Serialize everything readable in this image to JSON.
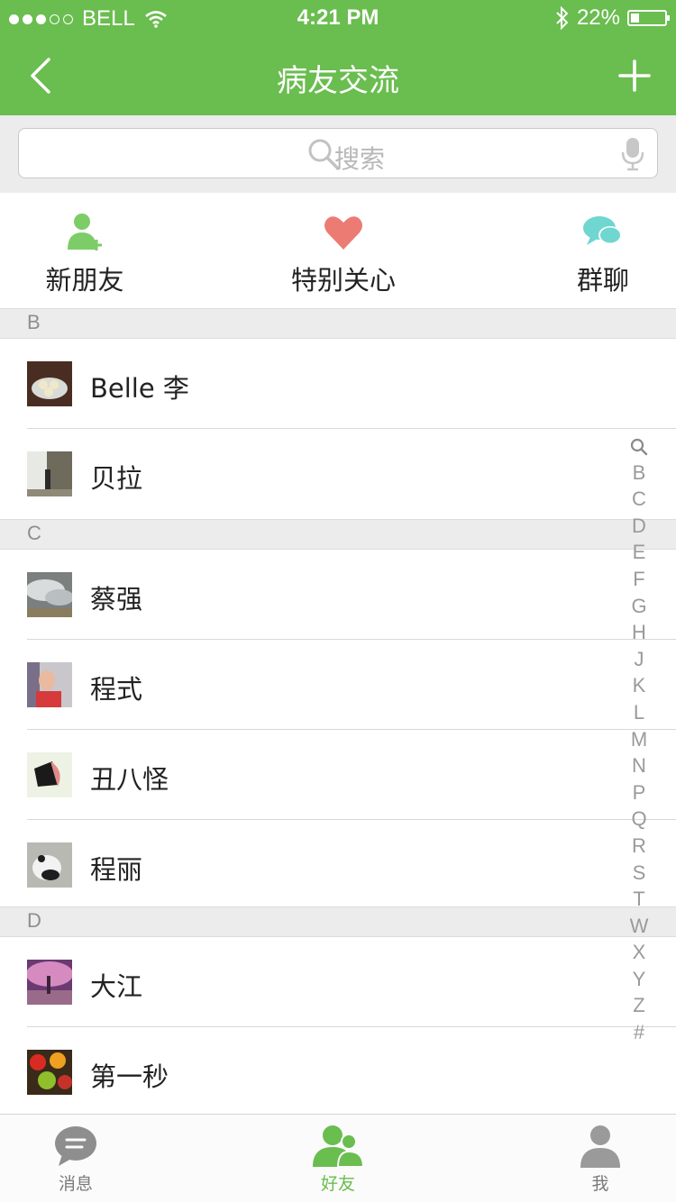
{
  "status": {
    "carrier": "BELL",
    "time": "4:21 PM",
    "battery": "22%",
    "battery_level": 0.22,
    "signal_bars": 3
  },
  "nav": {
    "title": "病友交流"
  },
  "search": {
    "placeholder": "搜索"
  },
  "quick": {
    "new_friend": "新朋友",
    "special_care": "特别关心",
    "group_chat": "群聊"
  },
  "sections": [
    {
      "letter": "B",
      "contacts": [
        {
          "name": "Belle 李"
        },
        {
          "name": "贝拉"
        }
      ]
    },
    {
      "letter": "C",
      "contacts": [
        {
          "name": "蔡强"
        },
        {
          "name": "程式"
        },
        {
          "name": "丑八怪"
        },
        {
          "name": "程丽"
        }
      ]
    },
    {
      "letter": "D",
      "contacts": [
        {
          "name": "大江"
        },
        {
          "name": "第一秒"
        }
      ]
    }
  ],
  "index_letters": [
    "B",
    "C",
    "D",
    "E",
    "F",
    "G",
    "H",
    "J",
    "K",
    "L",
    "M",
    "N",
    "P",
    "Q",
    "R",
    "S",
    "T",
    "W",
    "X",
    "Y",
    "Z",
    "#"
  ],
  "tabs": {
    "messages": "消息",
    "friends": "好友",
    "me": "我"
  },
  "colors": {
    "accent": "#6abd4f",
    "heart": "#ec7b73",
    "chat_bubble": "#6fd6d0",
    "new_friend_icon": "#7ccd68"
  }
}
